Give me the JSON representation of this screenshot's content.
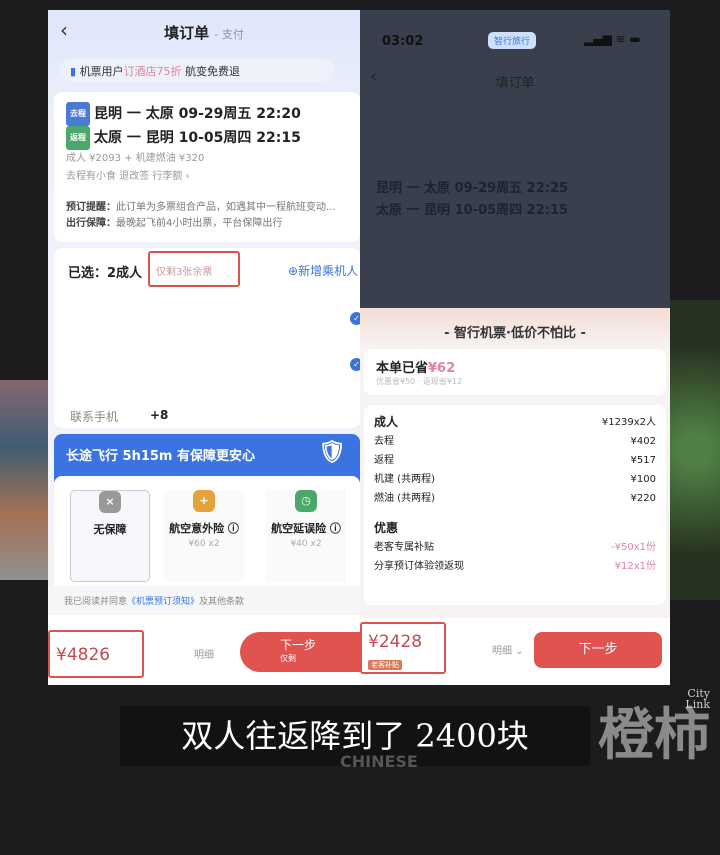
{
  "left": {
    "nav": {
      "title": "填订单",
      "step": "- 支付"
    },
    "promo": {
      "prefix": "机票用户",
      "highlight": "订酒店75折",
      "suffix": "航变免费退"
    },
    "flights": [
      {
        "tag": "去程",
        "route": "昆明 一 太原  09-29周五 22:20"
      },
      {
        "tag": "返程",
        "route": "太原 一 昆明  10-05周四 22:15"
      }
    ],
    "fare": "成人 ¥2093 + 机建燃油 ¥320",
    "perks": "去程有小食   退改签   行李额 ›",
    "notes": [
      {
        "k": "预订提醒：",
        "v": "此订单为多票组合产品，如遇其中一程航班变动..."
      },
      {
        "k": "出行保障：",
        "v": "最晚起飞前4小时出票，平台保障出行"
      }
    ],
    "passengers": {
      "selected": "已选：2成人",
      "remaining": "仅剩3张余票",
      "add": "新增乘机人"
    },
    "contact": {
      "label": "联系手机",
      "value": "+8"
    },
    "insurance": {
      "header": "长途飞行 5h15m 有保障更安心",
      "options": [
        {
          "name": "无保障",
          "price": ""
        },
        {
          "name": "航空意外险",
          "price": "¥60 x2"
        },
        {
          "name": "航空延误险",
          "price": "¥40 x2"
        }
      ]
    },
    "agreement": {
      "prefix": "我已阅读并同意",
      "link": "《机票预订须知》",
      "suffix": "及其他条款"
    },
    "total": "¥4826",
    "detail": "明细",
    "next": "下一步",
    "only": "仅剩"
  },
  "right": {
    "status": {
      "time": "03:02",
      "pill": "智行旅行"
    },
    "nav": {
      "title": "填订单"
    },
    "flights": [
      {
        "route": "昆明 一 太原  09-29周五 22:25"
      },
      {
        "route": "太原 一 昆明  10-05周四 22:15"
      }
    ],
    "sheet": {
      "banner": "- 智行机票·低价不怕比 -",
      "saved_label": "本单已省",
      "saved": "¥62",
      "saved_sub": "优惠省¥50 · 返现省¥12",
      "adult": {
        "label": "成人",
        "value": "¥1239x2人"
      },
      "items": [
        {
          "label": "去程",
          "value": "¥402"
        },
        {
          "label": "返程",
          "value": "¥517"
        },
        {
          "label": "机建 (共两程)",
          "value": "¥100"
        },
        {
          "label": "燃油 (共两程)",
          "value": "¥220"
        }
      ],
      "discount_title": "优惠",
      "discounts": [
        {
          "label": "老客专属补贴",
          "value": "-¥50x1份"
        },
        {
          "label": "分享预订体验领返现",
          "value": "¥12x1份"
        }
      ]
    },
    "total": "¥2428",
    "total_badge": "老客补贴",
    "detail": "明细 ⌄",
    "next": "下一步"
  },
  "subtitle": "双人往返降到了 2400块",
  "watermark": {
    "logo": "橙柿",
    "en1": "City",
    "en2": "Link",
    "bg": "CHINESE"
  },
  "colors": {
    "accent_red": "#e0534f",
    "blue": "#3b74e0"
  }
}
